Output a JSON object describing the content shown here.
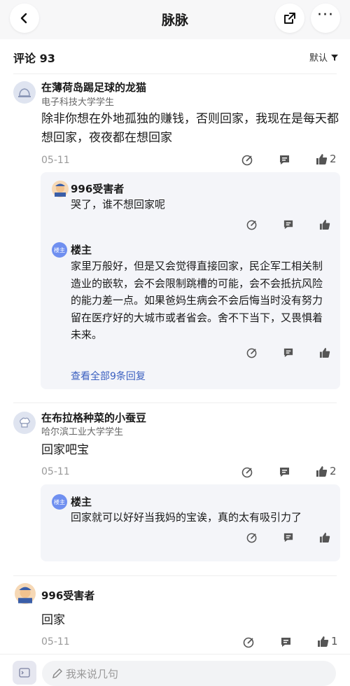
{
  "header": {
    "title": "脉脉"
  },
  "comments_header": {
    "label": "评论 93",
    "sort_label": "默认"
  },
  "comments": [
    {
      "user": "在薄荷岛踢足球的龙猫",
      "school": "电子科技大学学生",
      "text": "除非你想在外地孤独的赚钱，否则回家，我现在是每天都想回家，夜夜都在想回家",
      "date": "05-11",
      "likes": "2",
      "replies": [
        {
          "user": "996受害者",
          "text": "哭了，谁不想回家呢"
        },
        {
          "user": "楼主",
          "badge": "楼主",
          "text": "家里万般好，但是又会觉得直接回家，民企军工相关制造业的嵌软，会不会限制跳槽的可能，会不会抵抗风险的能力差一点。如果爸妈生病会不会后悔当时没有努力留在医疗好的大城市或者省会。舍不下当下，又畏惧着未来。"
        }
      ],
      "view_all": "查看全部9条回复"
    },
    {
      "user": "在布拉格种菜的小蚕豆",
      "school": "哈尔滨工业大学学生",
      "text": "回家吧宝",
      "date": "05-11",
      "likes": "2",
      "replies": [
        {
          "user": "楼主",
          "badge": "楼主",
          "text": "回家就可以好好当我妈的宝诶，真的太有吸引力了"
        }
      ]
    },
    {
      "user": "996受害者",
      "text": "回家",
      "date": "05-11",
      "likes": "1"
    }
  ],
  "input": {
    "placeholder": "我来说几句"
  }
}
